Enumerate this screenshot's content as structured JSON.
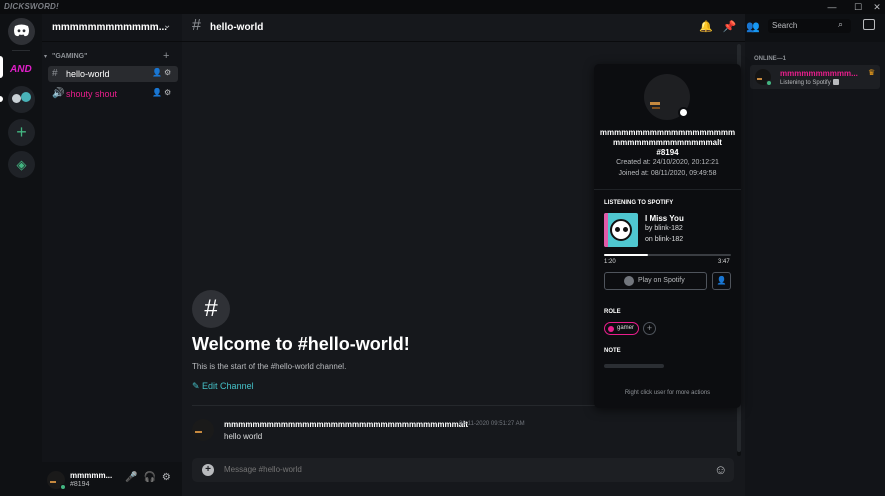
{
  "window": {
    "app_name": "DICKSWORD!",
    "controls": [
      "—",
      "☐",
      "✕"
    ]
  },
  "servers": {
    "text_server_label": "AND"
  },
  "guild": {
    "name": "mmmmmmmmmmmm...",
    "category": "\"GAMING\"",
    "channels": [
      {
        "name": "hello-world",
        "type": "text",
        "selected": true,
        "color": "#ffffff"
      },
      {
        "name": "shouty shout",
        "type": "voice",
        "selected": false,
        "color": "#e91e8c"
      }
    ]
  },
  "user_panel": {
    "name": "mmmmm...",
    "tag": "#8194"
  },
  "channel_header": {
    "title": "hello-world",
    "search_placeholder": "Search"
  },
  "welcome": {
    "icon": "#",
    "title": "Welcome to #hello-world!",
    "subtitle": "This is the start of the #hello-world channel.",
    "edit_label": "Edit Channel"
  },
  "messages": [
    {
      "author": "mmmmmmmmmmmmmmmmmmmmmmmmmmmmmmmmmalt",
      "timestamp": "08-11-2020 09:51:27 AM",
      "text": "hello world"
    }
  ],
  "composer": {
    "placeholder": "Message #hello-world"
  },
  "members": {
    "group_label": "ONLINE—1",
    "list": [
      {
        "name": "mmmmmmmmmm...",
        "status": "Listening to Spotify",
        "role_color": "#e91e8c",
        "owner": true
      }
    ]
  },
  "profile": {
    "name": "mmmmmmmmmmmmmmmmmmmmmmmmmmmmmmmmmalt",
    "tag": "#8194",
    "created": "Created at: 24/10/2020, 20:12:21",
    "joined": "Joined at: 08/11/2020, 09:49:58",
    "spotify": {
      "section": "LISTENING TO SPOTIFY",
      "title": "I Miss You",
      "artist": "by blink-182",
      "album": "on blink-182",
      "current": "1:20",
      "duration": "3:47",
      "progress_fraction": 0.35,
      "play_label": "Play on Spotify"
    },
    "role_section": "ROLE",
    "role": {
      "name": "gamer",
      "color": "#e91e8c"
    },
    "note_section": "NOTE",
    "footer": "Right click user for more actions"
  },
  "colors": {
    "accent_teal": "#45c1c8",
    "online": "#43b581",
    "role_pink": "#e91e8c",
    "muted_red": "#f04747"
  }
}
